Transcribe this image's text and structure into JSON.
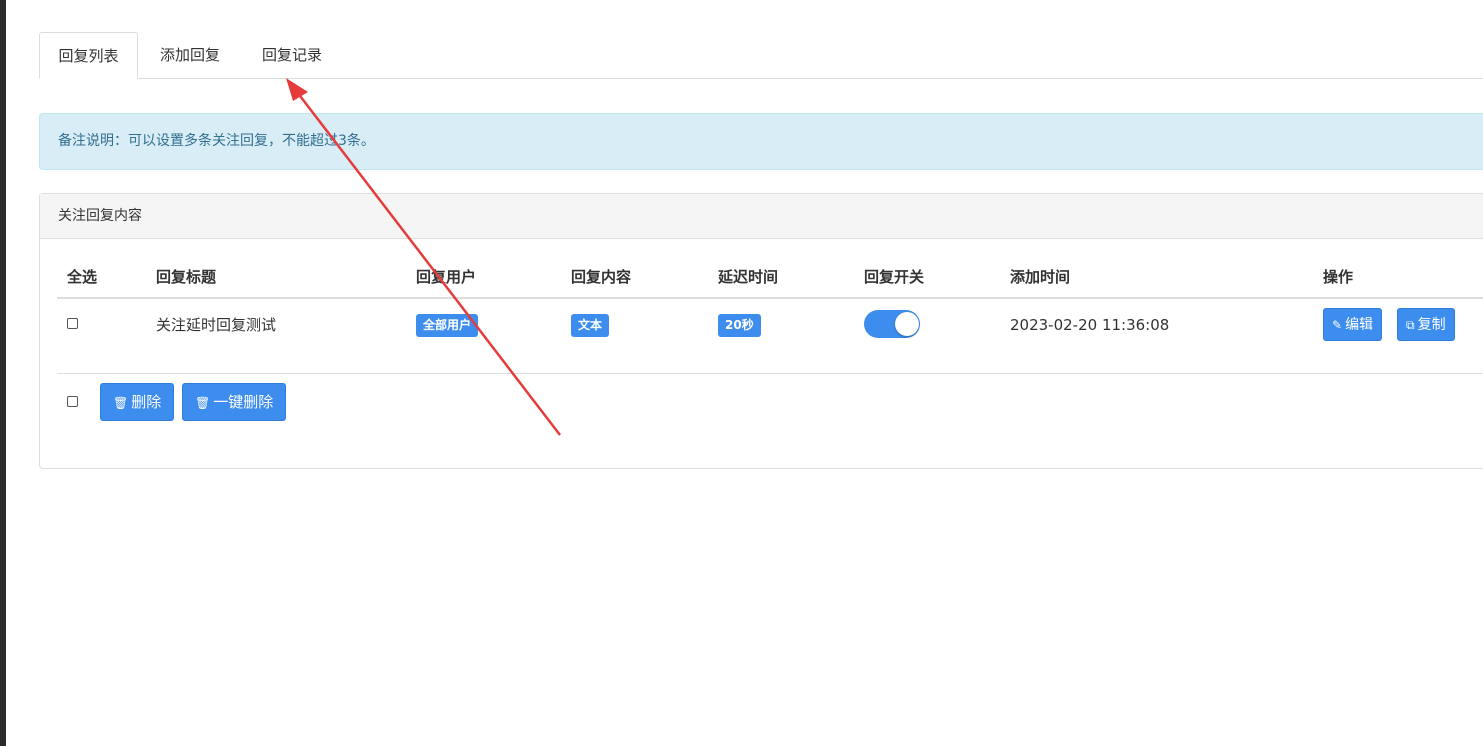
{
  "tabs": [
    {
      "label": "回复列表",
      "active": true
    },
    {
      "label": "添加回复",
      "active": false
    },
    {
      "label": "回复记录",
      "active": false
    }
  ],
  "alert": {
    "text": "备注说明：可以设置多条关注回复，不能超过3条。"
  },
  "panel": {
    "title": "关注回复内容"
  },
  "table": {
    "headers": [
      "全选",
      "回复标题",
      "回复用户",
      "回复内容",
      "延迟时间",
      "回复开关",
      "添加时间",
      "操作"
    ],
    "rows": [
      {
        "checked": false,
        "title": "关注延时回复测试",
        "user": "全部用户",
        "content": "文本",
        "delay": "20秒",
        "switch_on": true,
        "added": "2023-02-20 11:36:08",
        "actions": {
          "edit": "编辑",
          "copy": "复制"
        }
      }
    ]
  },
  "footer": {
    "delete_label": "删除",
    "delete_all_label": "一键删除"
  },
  "icons": {
    "edit": "edit-icon",
    "copy": "copy-icon",
    "trash": "trash-icon"
  },
  "colors": {
    "primary": "#3c8dee",
    "alert_bg": "#d9edf7",
    "alert_text": "#31708f",
    "annotation": "#e63b3b"
  }
}
